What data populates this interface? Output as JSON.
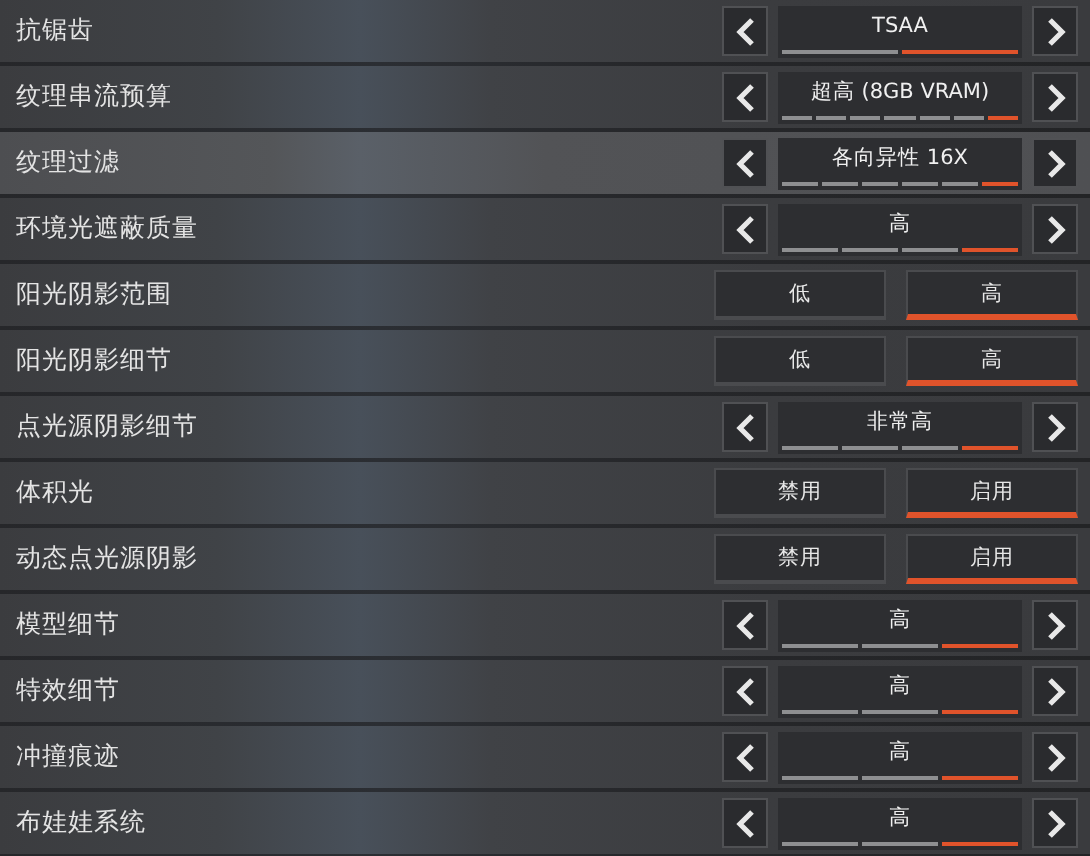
{
  "settings": [
    {
      "kind": "selector",
      "label": "抗锯齿",
      "highlighted": false,
      "value": "TSAA",
      "segments": [
        {
          "selected": false
        },
        {
          "selected": true
        }
      ]
    },
    {
      "kind": "selector",
      "label": "纹理串流预算",
      "highlighted": false,
      "value": "超高 (8GB VRAM)",
      "segments": [
        {
          "selected": false
        },
        {
          "selected": false
        },
        {
          "selected": false
        },
        {
          "selected": false
        },
        {
          "selected": false
        },
        {
          "selected": false
        },
        {
          "selected": true
        }
      ]
    },
    {
      "kind": "selector",
      "label": "纹理过滤",
      "highlighted": true,
      "value": "各向异性 16X",
      "segments": [
        {
          "selected": false
        },
        {
          "selected": false
        },
        {
          "selected": false
        },
        {
          "selected": false
        },
        {
          "selected": false
        },
        {
          "selected": true
        }
      ]
    },
    {
      "kind": "selector",
      "label": "环境光遮蔽质量",
      "highlighted": false,
      "value": "高",
      "segments": [
        {
          "selected": false
        },
        {
          "selected": false
        },
        {
          "selected": false
        },
        {
          "selected": true
        }
      ]
    },
    {
      "kind": "toggle",
      "label": "阳光阴影范围",
      "highlighted": false,
      "options": [
        {
          "label": "低",
          "selected": false
        },
        {
          "label": "高",
          "selected": true
        }
      ]
    },
    {
      "kind": "toggle",
      "label": "阳光阴影细节",
      "highlighted": false,
      "options": [
        {
          "label": "低",
          "selected": false
        },
        {
          "label": "高",
          "selected": true
        }
      ]
    },
    {
      "kind": "selector",
      "label": "点光源阴影细节",
      "highlighted": false,
      "value": "非常高",
      "segments": [
        {
          "selected": false
        },
        {
          "selected": false
        },
        {
          "selected": false
        },
        {
          "selected": true
        }
      ]
    },
    {
      "kind": "toggle",
      "label": "体积光",
      "highlighted": false,
      "options": [
        {
          "label": "禁用",
          "selected": false
        },
        {
          "label": "启用",
          "selected": true
        }
      ]
    },
    {
      "kind": "toggle",
      "label": "动态点光源阴影",
      "highlighted": false,
      "options": [
        {
          "label": "禁用",
          "selected": false
        },
        {
          "label": "启用",
          "selected": true
        }
      ]
    },
    {
      "kind": "selector",
      "label": "模型细节",
      "highlighted": false,
      "value": "高",
      "segments": [
        {
          "selected": false
        },
        {
          "selected": false
        },
        {
          "selected": true
        }
      ]
    },
    {
      "kind": "selector",
      "label": "特效细节",
      "highlighted": false,
      "value": "高",
      "segments": [
        {
          "selected": false
        },
        {
          "selected": false
        },
        {
          "selected": true
        }
      ]
    },
    {
      "kind": "selector",
      "label": "冲撞痕迹",
      "highlighted": false,
      "value": "高",
      "segments": [
        {
          "selected": false
        },
        {
          "selected": false
        },
        {
          "selected": true
        }
      ]
    },
    {
      "kind": "selector",
      "label": "布娃娃系统",
      "highlighted": false,
      "value": "高",
      "segments": [
        {
          "selected": false
        },
        {
          "selected": false
        },
        {
          "selected": true
        }
      ]
    }
  ]
}
